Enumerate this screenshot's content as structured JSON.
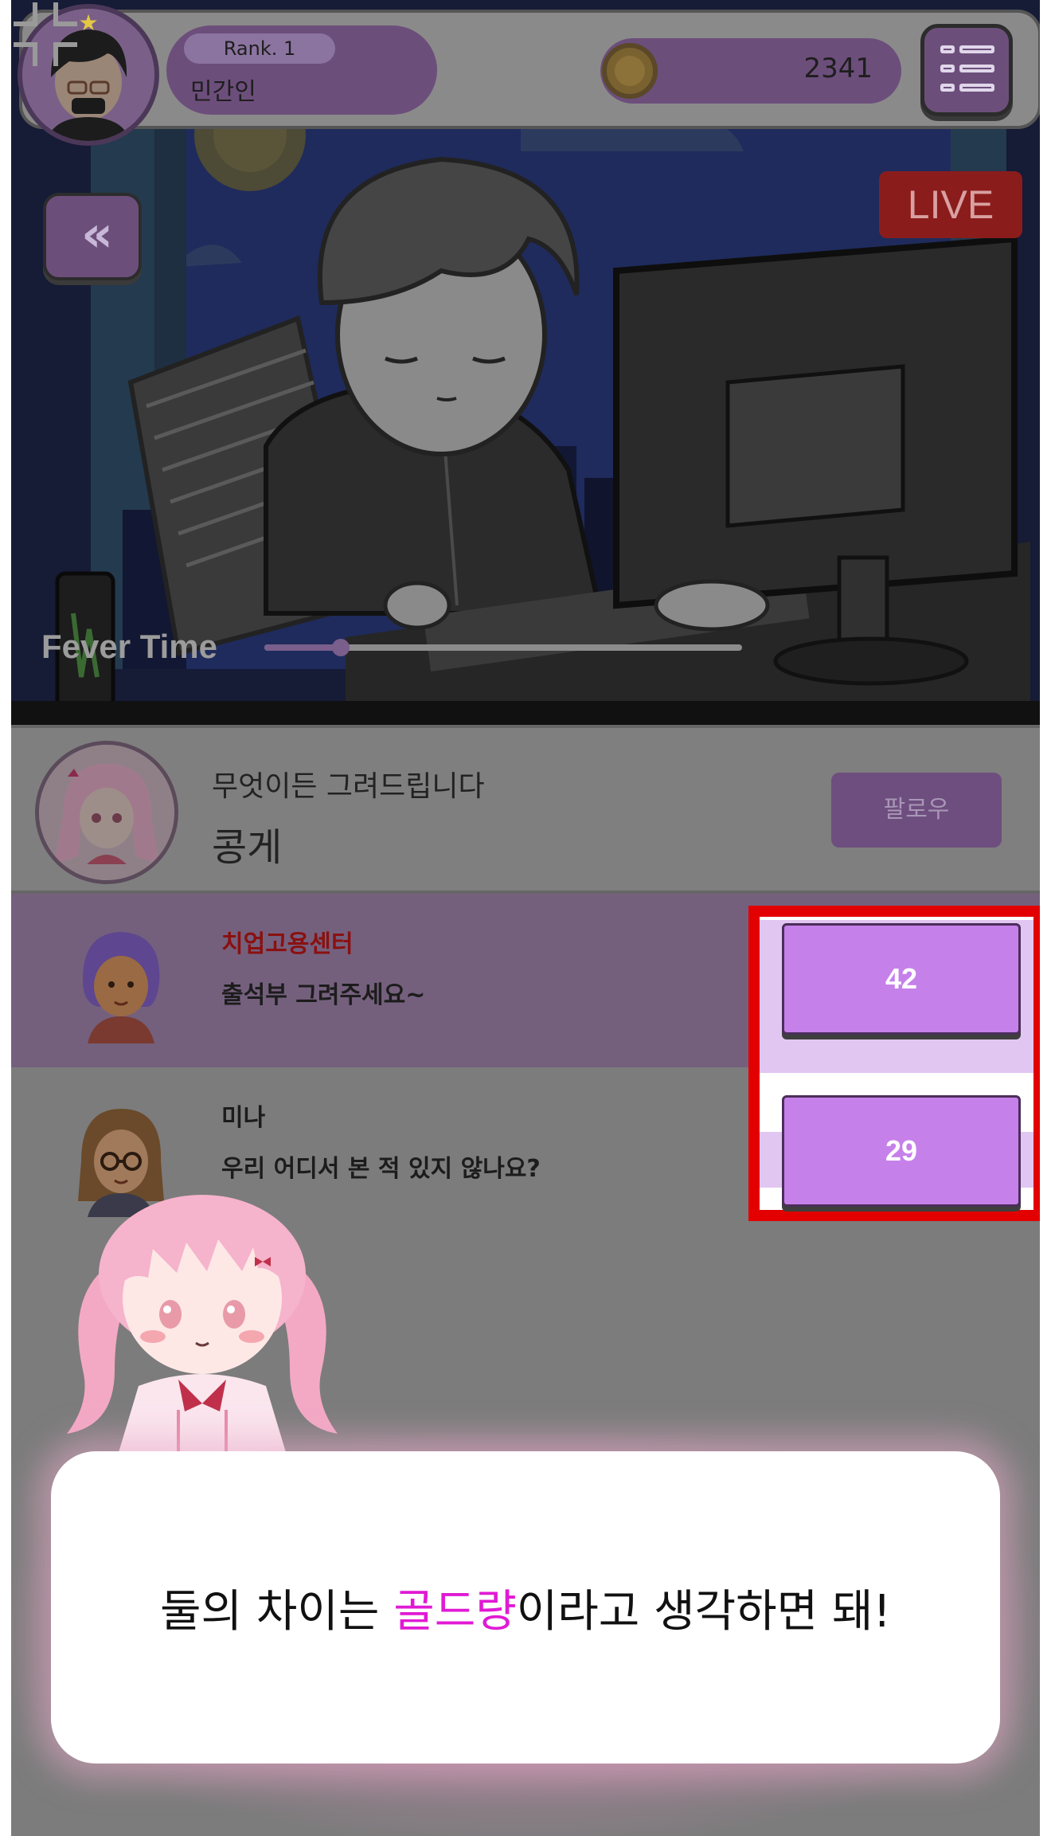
{
  "hud": {
    "rank_label": "Rank. 1",
    "player_name": "민간인",
    "gold": "2341",
    "star_icon": "star-icon",
    "coin_icon": "coin-icon",
    "menu_icon": "list-menu-icon"
  },
  "stream": {
    "back_icon": "double-chevron-left-icon",
    "live_label": "LIVE",
    "fever_label": "Fever Time",
    "fever_progress": 0.16,
    "collapse_icon": "collapse-icon"
  },
  "streamer": {
    "subtitle": "무엇이든 그려드립니다",
    "name": "콩게",
    "follow_label": "팔로우"
  },
  "chat": [
    {
      "user": "치업고용센터",
      "message": "출석부 그려주세요~",
      "user_color": "#8a1010",
      "highlighted": true
    },
    {
      "user": "미나",
      "message": "우리 어디서 본 적 있지 않나요?",
      "user_color": "#1c1c1c",
      "highlighted": false
    }
  ],
  "donations": [
    {
      "value": "42"
    },
    {
      "value": "29"
    }
  ],
  "dialog": {
    "before": "둘의 차이는 ",
    "highlight": "골드량",
    "after": "이라고 생각하면 돼!",
    "highlight_color": "#e01ad4"
  },
  "colors": {
    "accent_purple": "#c680ea",
    "highlight_border": "#e30000",
    "live_red": "#8b1c1c"
  }
}
